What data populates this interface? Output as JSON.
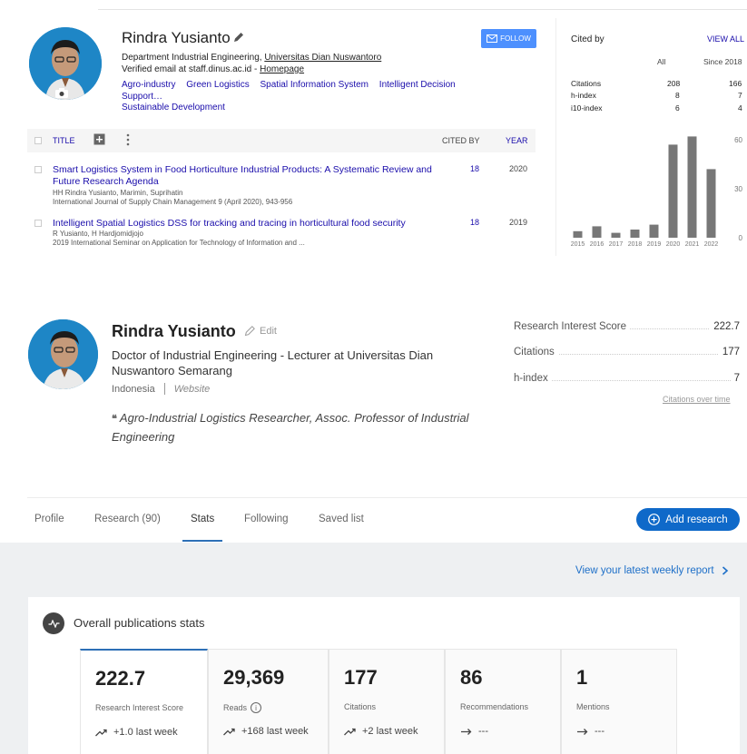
{
  "scholar": {
    "name": "Rindra Yusianto",
    "follow_label": "FOLLOW",
    "affiliation_prefix": "Department Industrial Engineering, ",
    "affiliation_link": "Universitas Dian Nuswantoro",
    "verified_prefix": "Verified email at staff.dinus.ac.id - ",
    "homepage_label": "Homepage",
    "interests": [
      "Agro-industry",
      "Green Logistics",
      "Spatial Information System",
      "Intelligent Decision Support…",
      "Sustainable Development"
    ],
    "table": {
      "title_label": "TITLE",
      "cited_by_label": "CITED BY",
      "year_label": "YEAR"
    },
    "articles": [
      {
        "title": "Smart Logistics System in Food Horticulture Industrial Products: A Systematic Review and Future Research Agenda",
        "authors": "HH Rindra Yusianto, Marimin, Suprihatin",
        "venue": "International Journal of Supply Chain Management 9 (April 2020), 943-956",
        "cited_by": "18",
        "year": "2020"
      },
      {
        "title": "Intelligent Spatial Logistics DSS for tracking and tracing in horticultural food security",
        "authors": "R Yusianto, H Hardjomidjojo",
        "venue": "2019 International Seminar on Application for Technology of Information and ...",
        "cited_by": "18",
        "year": "2019"
      }
    ],
    "cited_by": {
      "heading": "Cited by",
      "view_all": "VIEW ALL",
      "col_all": "All",
      "col_since": "Since 2018",
      "rows": [
        {
          "label": "Citations",
          "all": "208",
          "since": "166"
        },
        {
          "label": "h-index",
          "all": "8",
          "since": "7"
        },
        {
          "label": "i10-index",
          "all": "6",
          "since": "4"
        }
      ]
    },
    "chart_data": {
      "type": "bar",
      "categories": [
        "2015",
        "2016",
        "2017",
        "2018",
        "2019",
        "2020",
        "2021",
        "2022"
      ],
      "values": [
        4,
        7,
        3,
        5,
        8,
        57,
        62,
        42
      ],
      "ylim": [
        0,
        60
      ],
      "yticks": [
        "60",
        "30",
        "0"
      ],
      "color": "#777777"
    }
  },
  "researchgate": {
    "name": "Rindra Yusianto",
    "edit_label": "Edit",
    "title": "Doctor of Industrial Engineering - Lecturer at Universitas Dian Nuswantoro Semarang",
    "country": "Indonesia",
    "website": "Website",
    "quote": "Agro-Industrial Logistics Researcher, Assoc. Professor of Industrial Engineering",
    "scores": [
      {
        "label": "Research Interest Score",
        "value": "222.7"
      },
      {
        "label": "Citations",
        "value": "177"
      },
      {
        "label": "h-index",
        "value": "7"
      }
    ],
    "citations_over_time": "Citations over time",
    "tabs": [
      "Profile",
      "Research (90)",
      "Stats",
      "Following",
      "Saved list"
    ],
    "active_tab": "Stats",
    "add_research": "Add research",
    "weekly_report": "View your latest weekly report",
    "stats_title": "Overall publications stats",
    "stats": [
      {
        "value": "222.7",
        "label": "Research Interest Score",
        "change": "+1.0 last week"
      },
      {
        "value": "29,369",
        "label": "Reads",
        "change": "+168 last week"
      },
      {
        "value": "177",
        "label": "Citations",
        "change": "+2 last week"
      },
      {
        "value": "86",
        "label": "Recommendations",
        "change": "---"
      },
      {
        "value": "1",
        "label": "Mentions",
        "change": "---"
      }
    ],
    "accent_color": "#0f69c9"
  }
}
